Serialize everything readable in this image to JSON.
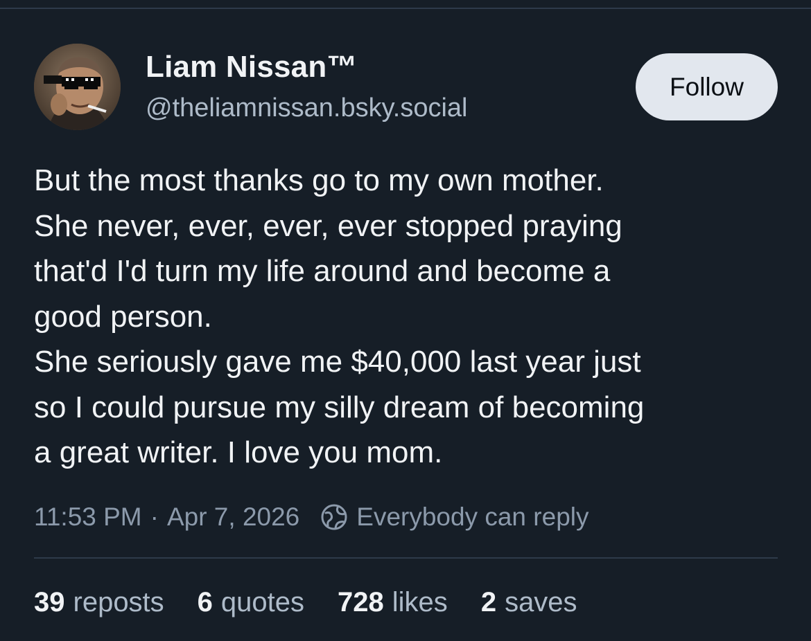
{
  "author": {
    "display_name": "Liam Nissan™",
    "handle": "@theliamnissan.bsky.social",
    "avatar_icon": "profile-photo"
  },
  "follow_button": {
    "label": "Follow"
  },
  "post": {
    "lines": [
      "But the most thanks go to my own mother.",
      "She never, ever, ever, ever stopped praying",
      "that'd I'd turn my life around and become a",
      "good person.",
      "She seriously gave me $40,000 last year just",
      "so I could pursue my silly dream of becoming",
      "a great writer. I love you mom."
    ]
  },
  "meta": {
    "time": "11:53 PM",
    "separator": "·",
    "date": "Apr 7, 2026",
    "reply_setting_icon": "globe-icon",
    "reply_setting": "Everybody can reply"
  },
  "stats": [
    {
      "count": "39",
      "label": "reposts"
    },
    {
      "count": "6",
      "label": "quotes"
    },
    {
      "count": "728",
      "label": "likes"
    },
    {
      "count": "2",
      "label": "saves"
    }
  ],
  "colors": {
    "background": "#161e27",
    "primary_text": "#f1f3f5",
    "secondary_text": "#aebbc9",
    "meta_text": "#8c9aab",
    "divider": "#2e3a4a",
    "follow_button_bg": "#e2e7ee"
  }
}
